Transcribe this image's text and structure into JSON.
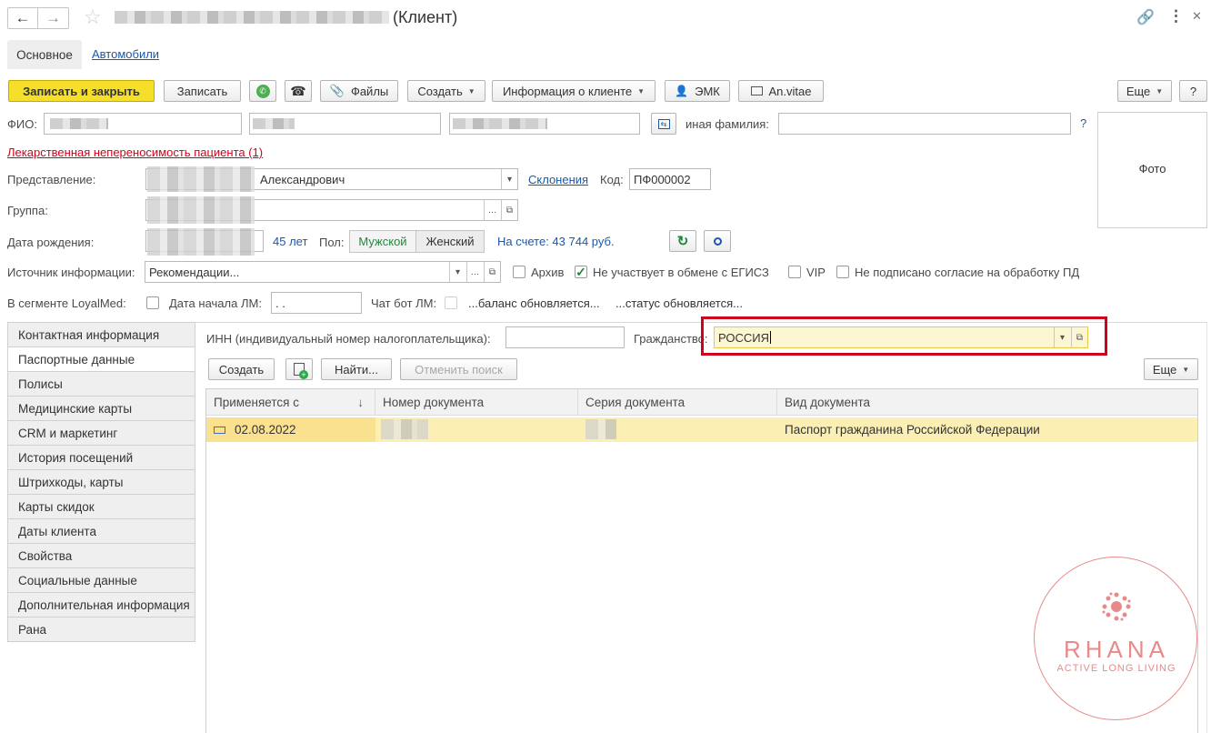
{
  "window": {
    "title_suffix": "(Клиент)",
    "nav_back": "←",
    "nav_forward": "→"
  },
  "tabs": {
    "main": "Основное",
    "cars": "Автомобили"
  },
  "toolbar": {
    "save_close": "Записать и закрыть",
    "save": "Записать",
    "files": "Файлы",
    "create": "Создать",
    "client_info": "Информация о клиенте",
    "emk": "ЭМК",
    "anvitae": "An.vitae",
    "more": "Еще",
    "help": "?"
  },
  "form": {
    "fio_label": "ФИО:",
    "other_surname_label": "иная фамилия:",
    "other_surname_value": "",
    "question_mark": "?",
    "photo_label": "Фото",
    "allergy_link": "Лекарственная непереносимость пациента (1)",
    "representation_label": "Представление:",
    "representation_value": "Александрович",
    "declensions_link": "Склонения",
    "code_label": "Код:",
    "code_value": "ПФ000002",
    "group_label": "Группа:",
    "birth_label": "Дата рождения:",
    "age_text": "45 лет",
    "gender_label": "Пол:",
    "gender_male": "Мужской",
    "gender_female": "Женский",
    "balance_text": "На счете: 43 744 руб.",
    "source_label": "Источник информации:",
    "source_value": "Рекомендации...",
    "archive_label": "Архив",
    "egisz_label": "Не участвует в обмене с ЕГИСЗ",
    "vip_label": "VIP",
    "consent_label": "Не подписано согласие на обработку ПД",
    "loyalmed_label": "В сегменте LoyalMed:",
    "lm_start_label": "Дата начала ЛМ:",
    "lm_start_value": " .  .",
    "chatbot_label": "Чат бот ЛМ:",
    "balance_updating": "...баланс обновляется...",
    "status_updating": "...статус обновляется..."
  },
  "sidebar": {
    "items": [
      "Контактная информация",
      "Паспортные данные",
      "Полисы",
      "Медицинские карты",
      "CRM и маркетинг",
      "История посещений",
      "Штрихкоды, карты",
      "Карты скидок",
      "Даты клиента",
      "Свойства",
      "Социальные данные",
      "Дополнительная информация",
      "Рана"
    ],
    "active_index": 1
  },
  "passport": {
    "inn_label": "ИНН (индивидуальный номер налогоплательщика):",
    "inn_value": "",
    "citizenship_label": "Гражданство:",
    "citizenship_value": "РОССИЯ",
    "create_btn": "Создать",
    "find_btn": "Найти...",
    "cancel_search_btn": "Отменить поиск",
    "more_btn": "Еще",
    "columns": [
      "Применяется с",
      "Номер документа",
      "Серия документа",
      "Вид документа"
    ],
    "sort_indicator": "↓",
    "rows": [
      {
        "date": "02.08.2022",
        "number": "",
        "series": "",
        "type": "Паспорт гражданина Российской Федерации"
      }
    ]
  },
  "watermark": {
    "brand": "RHANA",
    "tagline": "ACTIVE LONG LIVING"
  },
  "colors": {
    "primary_button": "#f5df2a",
    "link": "#1a58a8",
    "allergy_red": "#d0021b",
    "highlight_box": "#d0021b",
    "selected_row": "#fcefb4",
    "green_text": "#1a8a3a",
    "watermark": "#e88a8a"
  }
}
